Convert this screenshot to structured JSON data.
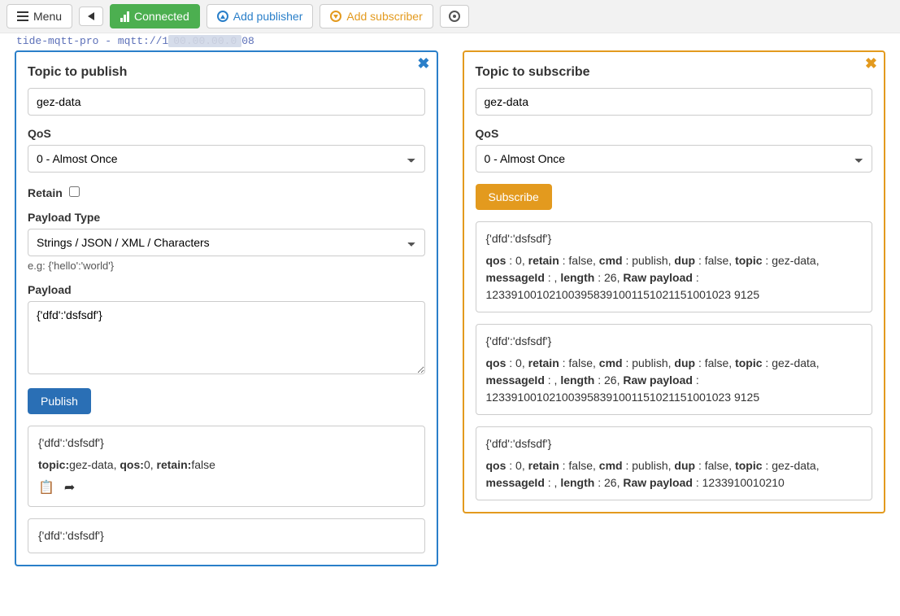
{
  "toolbar": {
    "menu_label": "Menu",
    "connected_label": "Connected",
    "add_publisher_label": "Add publisher",
    "add_subscriber_label": "Add subscriber"
  },
  "connection_string_prefix": "tide-mqtt-pro - mqtt://1",
  "connection_string_suffix": "08",
  "publisher": {
    "topic_label": "Topic to publish",
    "topic_value": "gez-data",
    "qos_label": "QoS",
    "qos_selected": "0 - Almost Once",
    "retain_label": "Retain",
    "retain_checked": false,
    "payload_type_label": "Payload Type",
    "payload_type_selected": "Strings / JSON / XML / Characters",
    "payload_type_hint": "e.g: {'hello':'world'}",
    "payload_label": "Payload",
    "payload_value": "{'dfd':'dsfsdf'}",
    "publish_button": "Publish",
    "history": [
      {
        "payload": "{'dfd':'dsfsdf'}",
        "meta_topic_label": "topic:",
        "meta_topic": "gez-data",
        "meta_qos_label": "qos:",
        "meta_qos": "0",
        "meta_retain_label": "retain:",
        "meta_retain": "false"
      },
      {
        "payload": "{'dfd':'dsfsdf'}"
      }
    ]
  },
  "subscriber": {
    "topic_label": "Topic to subscribe",
    "topic_value": "gez-data",
    "qos_label": "QoS",
    "qos_selected": "0 - Almost Once",
    "subscribe_button": "Subscribe",
    "messages": [
      {
        "payload": "{'dfd':'dsfsdf'}",
        "qos": "0",
        "retain": "false",
        "cmd": "publish",
        "dup": "false",
        "topic": "gez-data",
        "messageId": "",
        "length": "26",
        "raw_payload": "123391001021003958391001151021151001023 9125"
      },
      {
        "payload": "{'dfd':'dsfsdf'}",
        "qos": "0",
        "retain": "false",
        "cmd": "publish",
        "dup": "false",
        "topic": "gez-data",
        "messageId": "",
        "length": "26",
        "raw_payload": "123391001021003958391001151021151001023 9125"
      },
      {
        "payload": "{'dfd':'dsfsdf'}",
        "qos": "0",
        "retain": "false",
        "cmd": "publish",
        "dup": "false",
        "topic": "gez-data",
        "messageId": "",
        "length": "26",
        "raw_payload": "1233910010210"
      }
    ],
    "labels": {
      "qos": "qos",
      "retain": "retain",
      "cmd": "cmd",
      "dup": "dup",
      "topic": "topic",
      "messageId": "messageId",
      "length": "length",
      "raw_payload": "Raw payload"
    }
  }
}
